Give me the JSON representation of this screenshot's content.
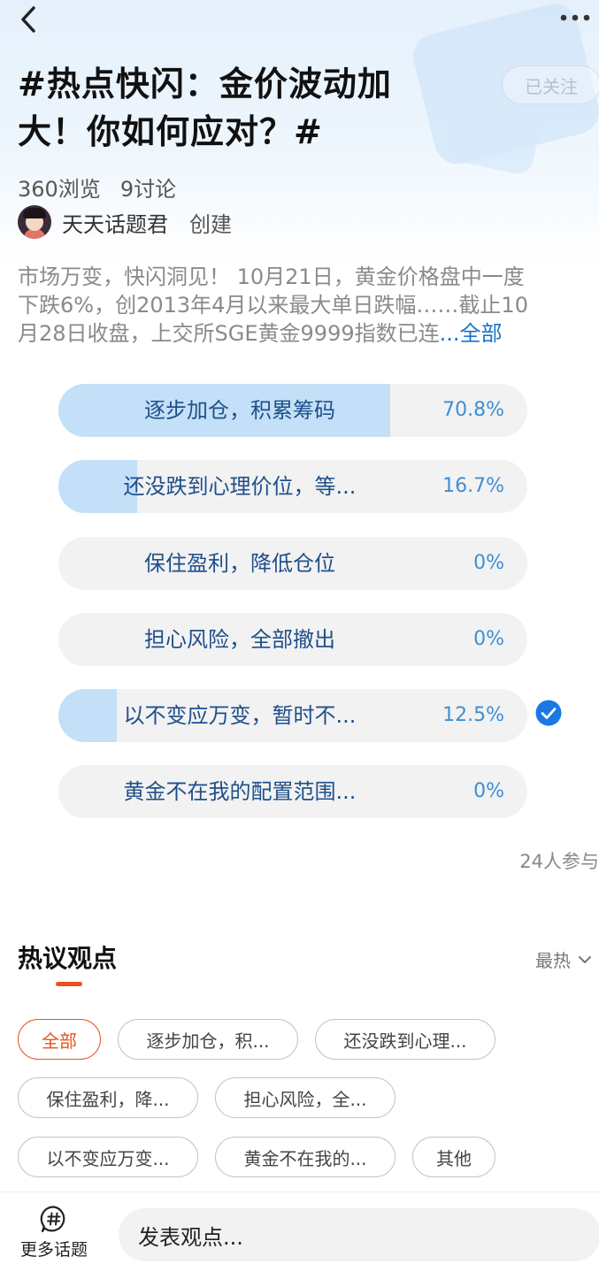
{
  "header": {
    "title": "#热点快闪：金价波动加大！你如何应对？#",
    "follow_label": "已关注",
    "views": "360浏览",
    "discussions": "9讨论",
    "creator_name": "天天话题君",
    "creator_action": "创建"
  },
  "description": {
    "line1": "市场万变，快闪洞见！ 10月21日，黄金价格盘中一度",
    "line2": "下跌6%，创2013年4月以来最大单日跌幅……截止10",
    "line3": "月28日收盘，上交所SGE黄金9999指数已连",
    "more_label": "...全部"
  },
  "poll": {
    "options": [
      {
        "label": "逐步加仓，积累筹码",
        "percent_label": "70.8%",
        "fill": 0.708,
        "selected": false
      },
      {
        "label": "还没跌到心理价位，等...",
        "percent_label": "16.7%",
        "fill": 0.167,
        "selected": false
      },
      {
        "label": "保住盈利，降低仓位",
        "percent_label": "0%",
        "fill": 0,
        "selected": false
      },
      {
        "label": "担心风险，全部撤出",
        "percent_label": "0%",
        "fill": 0,
        "selected": false
      },
      {
        "label": "以不变应万变，暂时不...",
        "percent_label": "12.5%",
        "fill": 0.125,
        "selected": true
      },
      {
        "label": "黄金不在我的配置范围...",
        "percent_label": "0%",
        "fill": 0,
        "selected": false
      }
    ],
    "participants": "24人参与"
  },
  "hot": {
    "title": "热议观点",
    "sort_label": "最热",
    "chips": [
      {
        "label": "全部",
        "active": true
      },
      {
        "label": "逐步加仓，积...",
        "active": false
      },
      {
        "label": "还没跌到心理...",
        "active": false
      },
      {
        "label": "保住盈利，降...",
        "active": false
      },
      {
        "label": "担心风险，全...",
        "active": false
      },
      {
        "label": "以不变应万变...",
        "active": false
      },
      {
        "label": "黄金不在我的...",
        "active": false
      },
      {
        "label": "其他",
        "active": false
      }
    ]
  },
  "bottom": {
    "topics_label": "更多话题",
    "comment_placeholder": "发表观点..."
  },
  "colors": {
    "accent": "#e8541e",
    "poll_fill": "#c3e0f8",
    "poll_text": "#1f4f8a",
    "check": "#1a78e6",
    "link": "#1a73c7"
  },
  "icons": [
    "back-arrow-icon",
    "more-dots-icon",
    "check-circle-icon",
    "chevron-down-icon",
    "hashtag-icon"
  ]
}
